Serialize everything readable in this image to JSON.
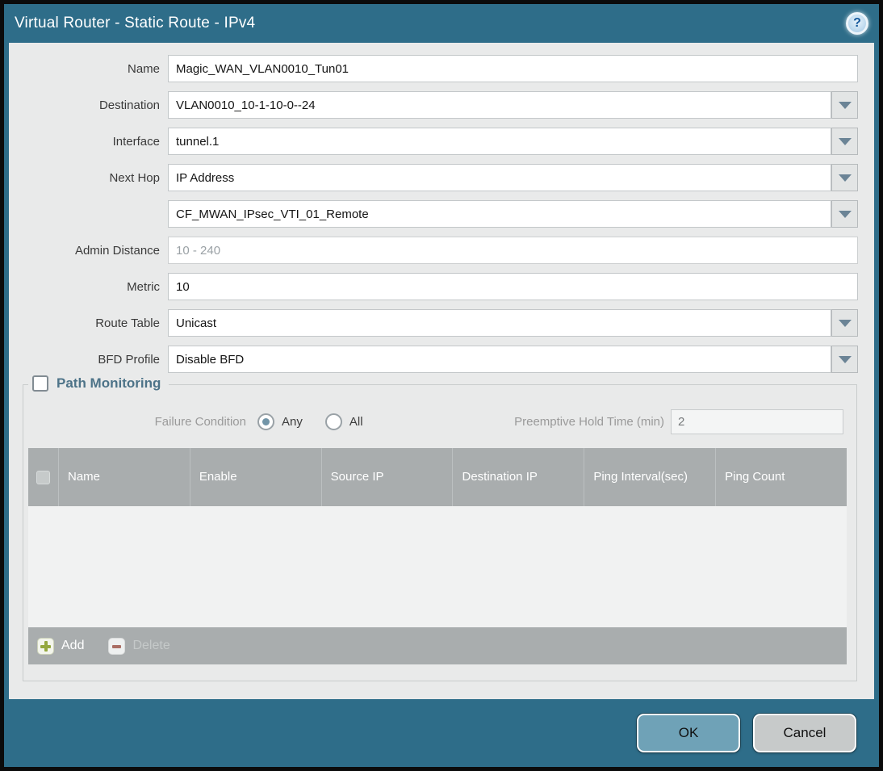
{
  "dialog": {
    "title": "Virtual Router - Static Route - IPv4"
  },
  "icons": {
    "help": "?"
  },
  "form": {
    "fields": [
      {
        "label": "Name",
        "value": "Magic_WAN_VLAN0010_Tun01",
        "placeholder": ""
      },
      {
        "label": "Destination",
        "value": "VLAN0010_10-1-10-0--24",
        "placeholder": ""
      },
      {
        "label": "Interface",
        "value": "tunnel.1",
        "placeholder": ""
      },
      {
        "label": "Next Hop",
        "value": "IP Address",
        "placeholder": ""
      },
      {
        "label": "",
        "value": "CF_MWAN_IPsec_VTI_01_Remote",
        "placeholder": ""
      },
      {
        "label": "Admin Distance",
        "value": "",
        "placeholder": "10 - 240"
      },
      {
        "label": "Metric",
        "value": "10",
        "placeholder": ""
      },
      {
        "label": "Route Table",
        "value": "Unicast",
        "placeholder": ""
      },
      {
        "label": "BFD Profile",
        "value": "Disable BFD",
        "placeholder": ""
      }
    ]
  },
  "path_monitoring": {
    "legend": "Path Monitoring",
    "checkbox_checked": false,
    "failure_condition": {
      "label": "Failure Condition",
      "options": [
        {
          "label": "Any",
          "selected": true
        },
        {
          "label": "All",
          "selected": false
        }
      ]
    },
    "preemptive_hold_time": {
      "label": "Preemptive Hold Time (min)",
      "value": "2"
    },
    "table": {
      "columns": [
        "Name",
        "Enable",
        "Source IP",
        "Destination IP",
        "Ping Interval(sec)",
        "Ping Count"
      ],
      "rows": []
    },
    "toolbar": {
      "add_label": "Add",
      "delete_label": "Delete"
    }
  },
  "footer": {
    "ok_label": "OK",
    "cancel_label": "Cancel"
  },
  "colors": {
    "titlebar": "#2e6d89",
    "content_bg": "#e9eaea",
    "table_header": "#a9adae",
    "ok_button": "#6fa2b7",
    "legend_text": "#4d7388",
    "dropdown_arrow": "#6b8496"
  }
}
